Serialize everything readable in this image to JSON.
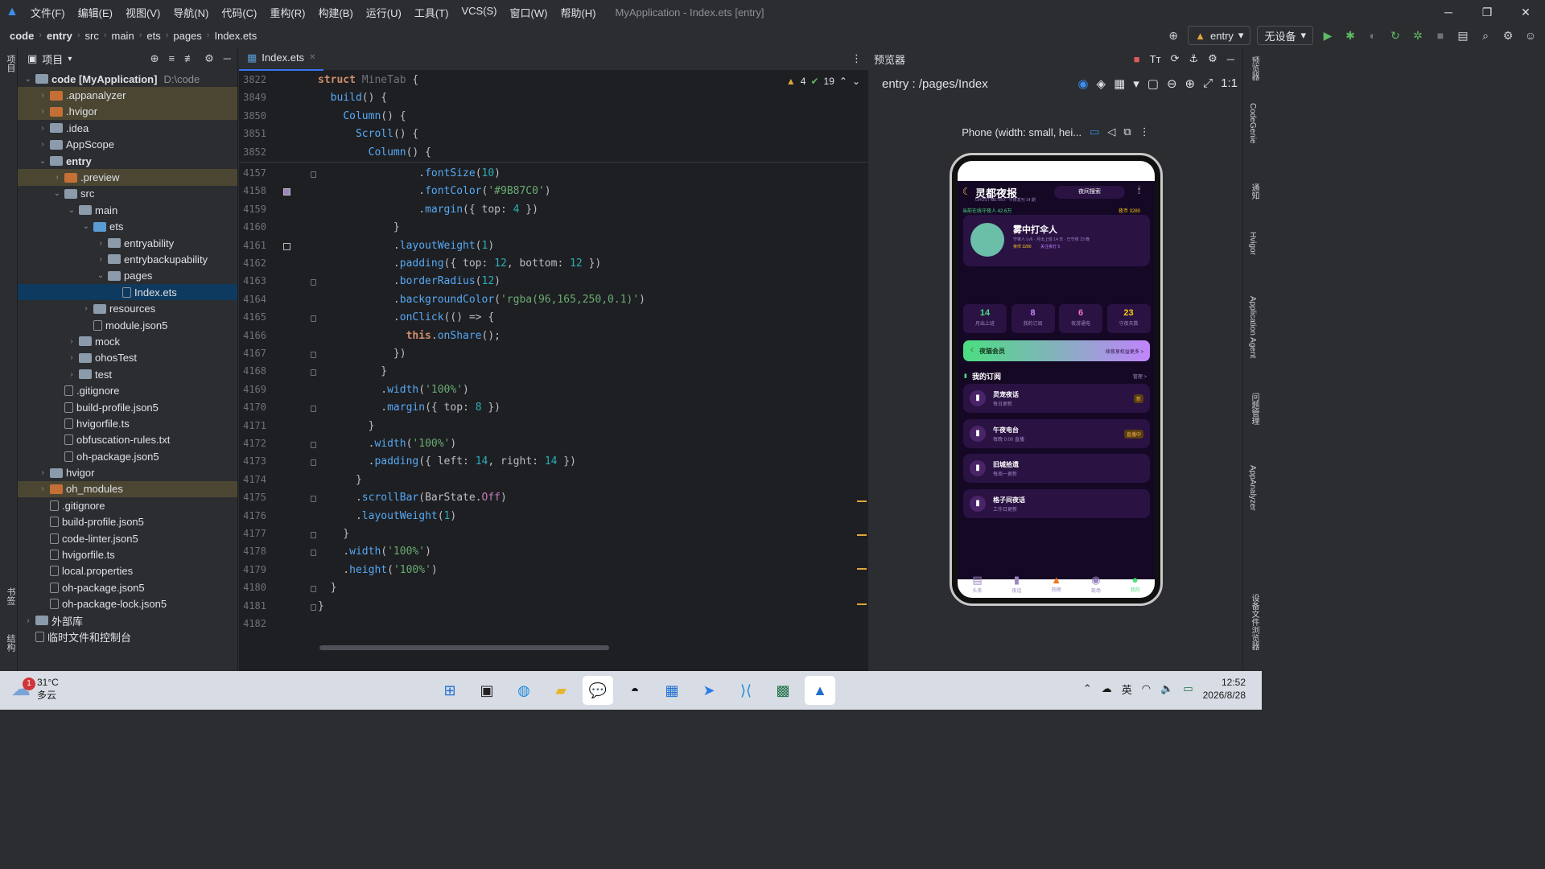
{
  "window": {
    "title": "MyApplication - Index.ets [entry]",
    "menu": [
      "文件(F)",
      "编辑(E)",
      "视图(V)",
      "导航(N)",
      "代码(C)",
      "重构(R)",
      "构建(B)",
      "运行(U)",
      "工具(T)",
      "VCS(S)",
      "窗口(W)",
      "帮助(H)"
    ]
  },
  "breadcrumb": [
    "code",
    "entry",
    "src",
    "main",
    "ets",
    "pages",
    "Index.ets"
  ],
  "runbar": {
    "config": "entry",
    "device": "无设备"
  },
  "project": {
    "title": "项目",
    "tree": [
      {
        "label": "code [MyApplication]",
        "extra": "D:\\code",
        "depth": 0,
        "arrow": "v",
        "kind": "folder",
        "state": ""
      },
      {
        "label": ".appanalyzer",
        "depth": 1,
        "arrow": ">",
        "kind": "folder org",
        "state": "hl"
      },
      {
        "label": ".hvigor",
        "depth": 1,
        "arrow": ">",
        "kind": "folder org",
        "state": "hl"
      },
      {
        "label": ".idea",
        "depth": 1,
        "arrow": ">",
        "kind": "folder",
        "state": ""
      },
      {
        "label": "AppScope",
        "depth": 1,
        "arrow": ">",
        "kind": "folder",
        "state": ""
      },
      {
        "label": "entry",
        "depth": 1,
        "arrow": "v",
        "kind": "folder",
        "state": ""
      },
      {
        "label": ".preview",
        "depth": 2,
        "arrow": ">",
        "kind": "folder org",
        "state": "hl"
      },
      {
        "label": "src",
        "depth": 2,
        "arrow": "v",
        "kind": "folder",
        "state": ""
      },
      {
        "label": "main",
        "depth": 3,
        "arrow": "v",
        "kind": "folder",
        "state": ""
      },
      {
        "label": "ets",
        "depth": 4,
        "arrow": "v",
        "kind": "folder blue",
        "state": ""
      },
      {
        "label": "entryability",
        "depth": 5,
        "arrow": ">",
        "kind": "folder",
        "state": ""
      },
      {
        "label": "entrybackupability",
        "depth": 5,
        "arrow": ">",
        "kind": "folder",
        "state": ""
      },
      {
        "label": "pages",
        "depth": 5,
        "arrow": "v",
        "kind": "folder",
        "state": ""
      },
      {
        "label": "Index.ets",
        "depth": 6,
        "arrow": "",
        "kind": "file",
        "state": "sel"
      },
      {
        "label": "resources",
        "depth": 4,
        "arrow": ">",
        "kind": "folder",
        "state": ""
      },
      {
        "label": "module.json5",
        "depth": 4,
        "arrow": "",
        "kind": "file",
        "state": ""
      },
      {
        "label": "mock",
        "depth": 3,
        "arrow": ">",
        "kind": "folder",
        "state": ""
      },
      {
        "label": "ohosTest",
        "depth": 3,
        "arrow": ">",
        "kind": "folder",
        "state": ""
      },
      {
        "label": "test",
        "depth": 3,
        "arrow": ">",
        "kind": "folder",
        "state": ""
      },
      {
        "label": ".gitignore",
        "depth": 2,
        "arrow": "",
        "kind": "file",
        "state": ""
      },
      {
        "label": "build-profile.json5",
        "depth": 2,
        "arrow": "",
        "kind": "file",
        "state": ""
      },
      {
        "label": "hvigorfile.ts",
        "depth": 2,
        "arrow": "",
        "kind": "file",
        "state": ""
      },
      {
        "label": "obfuscation-rules.txt",
        "depth": 2,
        "arrow": "",
        "kind": "file",
        "state": ""
      },
      {
        "label": "oh-package.json5",
        "depth": 2,
        "arrow": "",
        "kind": "file",
        "state": ""
      },
      {
        "label": "hvigor",
        "depth": 1,
        "arrow": ">",
        "kind": "folder",
        "state": ""
      },
      {
        "label": "oh_modules",
        "depth": 1,
        "arrow": ">",
        "kind": "folder org",
        "state": "hl"
      },
      {
        "label": ".gitignore",
        "depth": 1,
        "arrow": "",
        "kind": "file",
        "state": ""
      },
      {
        "label": "build-profile.json5",
        "depth": 1,
        "arrow": "",
        "kind": "file",
        "state": ""
      },
      {
        "label": "code-linter.json5",
        "depth": 1,
        "arrow": "",
        "kind": "file",
        "state": ""
      },
      {
        "label": "hvigorfile.ts",
        "depth": 1,
        "arrow": "",
        "kind": "file",
        "state": ""
      },
      {
        "label": "local.properties",
        "depth": 1,
        "arrow": "",
        "kind": "file",
        "state": ""
      },
      {
        "label": "oh-package.json5",
        "depth": 1,
        "arrow": "",
        "kind": "file",
        "state": ""
      },
      {
        "label": "oh-package-lock.json5",
        "depth": 1,
        "arrow": "",
        "kind": "file",
        "state": ""
      },
      {
        "label": "外部库",
        "depth": 0,
        "arrow": ">",
        "kind": "folder",
        "state": ""
      },
      {
        "label": "临时文件和控制台",
        "depth": 0,
        "arrow": "",
        "kind": "file",
        "state": ""
      }
    ]
  },
  "editor": {
    "tab": "Index.ets",
    "inspections": {
      "warnings": "4",
      "ok": "19"
    },
    "lines": [
      {
        "n": "3822",
        "html": "<span class='kw'>struct</span> <span style='color:#6f737a'>MineTab</span> {"
      },
      {
        "n": "3849",
        "html": "  <span class='fn'>build</span>() {"
      },
      {
        "n": "3850",
        "html": "    <span class='fn'>Column</span>() {"
      },
      {
        "n": "3851",
        "html": "      <span class='fn'>Scroll</span>() {"
      },
      {
        "n": "3852",
        "html": "        <span class='fn'>Column</span>() {"
      },
      {
        "n": "4157",
        "html": "                .<span class='fn2'>fontSize</span>(<span class='nu'>10</span>)"
      },
      {
        "n": "4158",
        "html": "                .<span class='fn2'>fontColor</span>(<span class='st'>'#9B87C0'</span>)"
      },
      {
        "n": "4159",
        "html": "                .<span class='fn2'>margin</span>({ top: <span class='nu'>4</span> })"
      },
      {
        "n": "4160",
        "html": "            }"
      },
      {
        "n": "4161",
        "html": "            .<span class='fn2'>layoutWeight</span>(<span class='nu'>1</span>)"
      },
      {
        "n": "4162",
        "html": "            .<span class='fn2'>padding</span>({ top: <span class='nu'>12</span>, bottom: <span class='nu'>12</span> })"
      },
      {
        "n": "4163",
        "html": "            .<span class='fn2'>borderRadius</span>(<span class='nu'>12</span>)"
      },
      {
        "n": "4164",
        "html": "            .<span class='fn2'>backgroundColor</span>(<span class='st'>'rgba(96,165,250,0.1)'</span>)"
      },
      {
        "n": "4165",
        "html": "            .<span class='fn2'>onClick</span>(() => {"
      },
      {
        "n": "4166",
        "html": "              <span class='kw'>this</span>.<span class='fn2'>onShare</span>();"
      },
      {
        "n": "4167",
        "html": "            })"
      },
      {
        "n": "4168",
        "html": "          }"
      },
      {
        "n": "4169",
        "html": "          .<span class='fn2'>width</span>(<span class='st'>'100%'</span>)"
      },
      {
        "n": "4170",
        "html": "          .<span class='fn2'>margin</span>({ top: <span class='nu'>8</span> })"
      },
      {
        "n": "4171",
        "html": "        }"
      },
      {
        "n": "4172",
        "html": "        .<span class='fn2'>width</span>(<span class='st'>'100%'</span>)"
      },
      {
        "n": "4173",
        "html": "        .<span class='fn2'>padding</span>({ left: <span class='nu'>14</span>, right: <span class='nu'>14</span> })"
      },
      {
        "n": "4174",
        "html": "      }"
      },
      {
        "n": "4175",
        "html": "      .<span class='fn2'>scrollBar</span>(BarState.<span class='pr'>Off</span>)"
      },
      {
        "n": "4176",
        "html": "      .<span class='fn2'>layoutWeight</span>(<span class='nu'>1</span>)"
      },
      {
        "n": "4177",
        "html": "    }"
      },
      {
        "n": "4178",
        "html": "    .<span class='fn2'>width</span>(<span class='st'>'100%'</span>)"
      },
      {
        "n": "4179",
        "html": "    .<span class='fn2'>height</span>(<span class='st'>'100%'</span>)"
      },
      {
        "n": "4180",
        "html": "  }"
      },
      {
        "n": "4181",
        "html": "}"
      },
      {
        "n": "4182",
        "html": ""
      }
    ]
  },
  "preview": {
    "title": "预览器",
    "path": "entry : /pages/Index",
    "device": "Phone (width: small, hei...",
    "app": {
      "title": "灵都夜报",
      "subtitle": "GHOST METRO · 午夜发刊 14 期",
      "search": "夜间搜索",
      "online": "当前在线守夜人 42.6万",
      "coins_top": "夜币 3280",
      "username": "雾中打伞人",
      "user_line1": "守夜人 Lv6 · 月出上班 14 天 · 已守夜 23 晚",
      "user_coins": "夜币 3280",
      "user_follow": "关注夜灯 5",
      "stats": [
        {
          "n": "14",
          "l": "月出上班",
          "c": "#4ade80"
        },
        {
          "n": "8",
          "l": "我的订阅",
          "c": "#c084fc"
        },
        {
          "n": "6",
          "l": "夜游通电",
          "c": "#f472b6"
        },
        {
          "n": "23",
          "l": "守夜天数",
          "c": "#facc15"
        }
      ],
      "vip": "夜猫会员",
      "vip_right": "续夜享权益更多 >",
      "subs_title": "我的订阅",
      "subs_more": "管理 >",
      "subs": [
        {
          "t": "灵宠夜话",
          "s": "每日更新",
          "badge": "新"
        },
        {
          "t": "午夜电台",
          "s": "每晚 0:00 直播",
          "badge": "直播中"
        },
        {
          "t": "旧城拾遗",
          "s": "每周一更新",
          "badge": ""
        },
        {
          "t": "格子间夜话",
          "s": "工作日更新",
          "badge": ""
        }
      ],
      "tabs": [
        "头条",
        "夜话",
        "热榜",
        "现场",
        "我的"
      ]
    }
  },
  "rightstrip": [
    "预览器",
    "CodeGenie",
    "通知",
    "Hvigor",
    "Application Agent",
    "问题管理",
    "AppAnalyzer",
    "设备文件浏览器"
  ],
  "leftstrip": [
    "项目",
    "书签",
    "结构"
  ],
  "taskbar": {
    "temp": "31°C",
    "weather": "多云",
    "badge": "1",
    "ime": "英",
    "time": "12:52",
    "date": "2026/8/28"
  }
}
